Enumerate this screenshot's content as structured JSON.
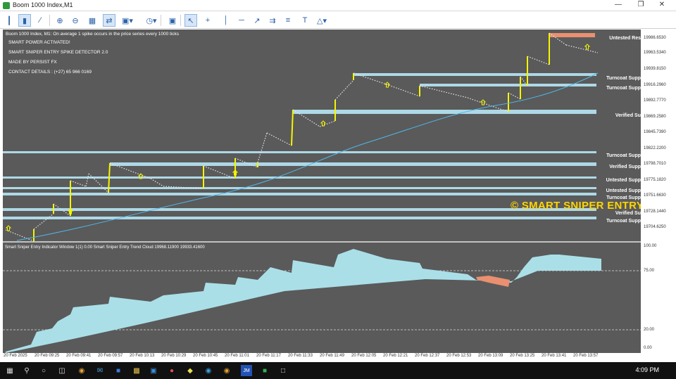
{
  "window": {
    "title": "Boom 1000 Index,M1"
  },
  "colors": {
    "chart_bg": "#5a5a5a",
    "level_band": "#aed8e6",
    "spike": "#f5f500",
    "ma_line": "#4fb8e8",
    "resistance_band": "#e99070",
    "cloud": "#aadfe8",
    "watermark": "#ffd400"
  },
  "chart": {
    "header": "Boom 1000 Index, M1:  On average 1 spike occurs in the price series every 1000 ticks",
    "info_lines": [
      "SMART POWER ACTIVATED!",
      "SMART SNIPER ENTRY SPIKE DETECTOR 2.0",
      "MADE BY PERSIST FX",
      "CONTACT DETAILS : (+27) 65 966 0169"
    ],
    "level_labels": [
      "Untested Res",
      "Turncoat Supp",
      "Turncoat Supp",
      "Verified Su",
      "Turncoat Supp",
      "Verified Supp",
      "Untested Supp",
      "Untested Supp",
      "Turncoat Supp",
      "Verified Su",
      "Turncoat Supp"
    ],
    "price_ticks": [
      "19986.6530",
      "19963.5340",
      "19939.8150",
      "19916.2960",
      "19892.7770",
      "19869.2580",
      "19845.7390",
      "19822.2200",
      "19798.7010",
      "19775.1820",
      "19751.6630",
      "19728.1440",
      "19704.6250"
    ],
    "watermark": "© SMART SNIPER ENTRY"
  },
  "oscillator": {
    "header": "Smart Sniper Entry Indicator Window 1(1) 0.00  Smart Sniper Entry Trend Cloud 19968.11900 19933.41600",
    "ticks": [
      "100.00",
      "75.00",
      "20.00",
      "0.00"
    ]
  },
  "time_axis": [
    "20 Feb 2025",
    "20 Feb 09:25",
    "20 Feb 09:41",
    "20 Feb 09:57",
    "20 Feb 10:13",
    "20 Feb 10:29",
    "20 Feb 10:45",
    "20 Feb 11:01",
    "20 Feb 11:17",
    "20 Feb 11:33",
    "20 Feb 11:49",
    "20 Feb 12:05",
    "20 Feb 12:21",
    "20 Feb 12:37",
    "20 Feb 12:53",
    "20 Feb 13:09",
    "20 Feb 13:25",
    "20 Feb 13:41",
    "20 Feb 13:57"
  ],
  "taskbar": {
    "time": "4:09 PM"
  },
  "toolbar_icons": [
    "bar-chart-icon",
    "candles-icon",
    "line-chart-icon",
    "zoom-in-icon",
    "zoom-out-icon",
    "tile-windows-icon",
    "indicators-icon",
    "periods-icon",
    "templates-icon",
    "screenshot-icon",
    "cursor-icon",
    "crosshair-icon",
    "vertical-line-icon",
    "horizontal-line-icon",
    "trendline-icon",
    "channel-icon",
    "fibonacci-icon",
    "text-icon",
    "shapes-icon"
  ]
}
